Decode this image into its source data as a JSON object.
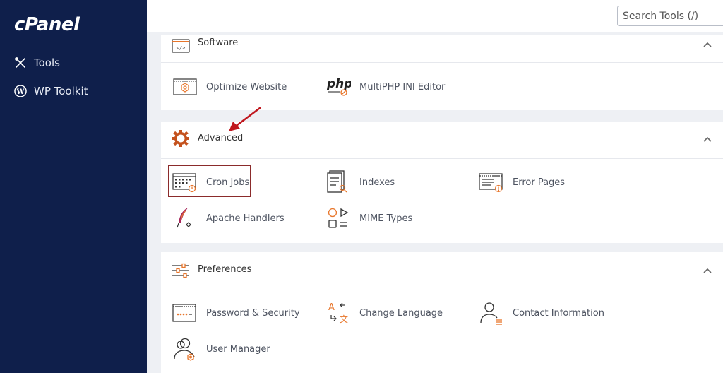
{
  "sidebar": {
    "logo": "cPanel",
    "items": [
      {
        "label": "Tools",
        "icon": "tools-icon"
      },
      {
        "label": "WP Toolkit",
        "icon": "wordpress-icon"
      }
    ]
  },
  "search": {
    "placeholder": "Search Tools (/)"
  },
  "sections": {
    "software": {
      "title": "Software",
      "items": [
        {
          "label": "Optimize Website"
        },
        {
          "label": "MultiPHP INI Editor"
        }
      ]
    },
    "advanced": {
      "title": "Advanced",
      "items": [
        {
          "label": "Cron Jobs"
        },
        {
          "label": "Indexes"
        },
        {
          "label": "Error Pages"
        },
        {
          "label": "Apache Handlers"
        },
        {
          "label": "MIME Types"
        }
      ]
    },
    "preferences": {
      "title": "Preferences",
      "items": [
        {
          "label": "Password & Security"
        },
        {
          "label": "Change Language"
        },
        {
          "label": "Contact Information"
        },
        {
          "label": "User Manager"
        }
      ]
    }
  },
  "colors": {
    "sidebar": "#0f1f4b",
    "accent": "#e8762b",
    "highlight": "#8b2b2b"
  }
}
